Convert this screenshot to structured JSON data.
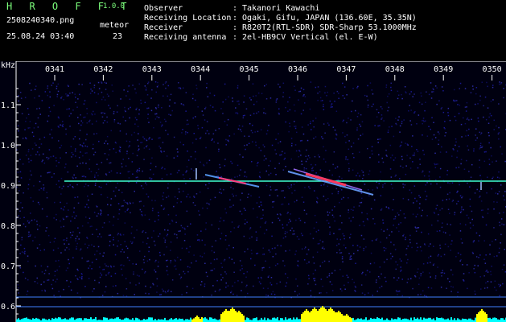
{
  "header": {
    "app_name": "H R O F F T",
    "version": "1.0.0",
    "filename": "2508240340.png",
    "datetime": "25.08.24 03:40",
    "count_label": "meteor",
    "count_value": "23",
    "info": [
      {
        "key": "Observer",
        "value": ": Takanori Kawachi"
      },
      {
        "key": "Receiving Location",
        "value": ": Ogaki, Gifu, JAPAN (136.60E, 35.35N)"
      },
      {
        "key": "Receiver",
        "value": ": R820T2(RTL-SDR) SDR-Sharp 53.1000MHz"
      },
      {
        "key": "Receiving antenna",
        "value": ": 2el-HB9CV Vertical (el. E-W)"
      }
    ]
  },
  "spectrogram": {
    "y_unit": "kHz",
    "x_ticks": [
      "0341",
      "0342",
      "0343",
      "0344",
      "0345",
      "0346",
      "0347",
      "0348",
      "0349",
      "0350"
    ],
    "y_ticks": [
      "1.1",
      "1.0",
      "0.9",
      "0.8",
      "0.7",
      "0.6"
    ],
    "colors": {
      "noise": "#0a0a50",
      "carrier": "#40ffd0",
      "axis": "#ffffff",
      "signal_bar": "#00ffff",
      "signal_peak": "#ffff00"
    }
  }
}
